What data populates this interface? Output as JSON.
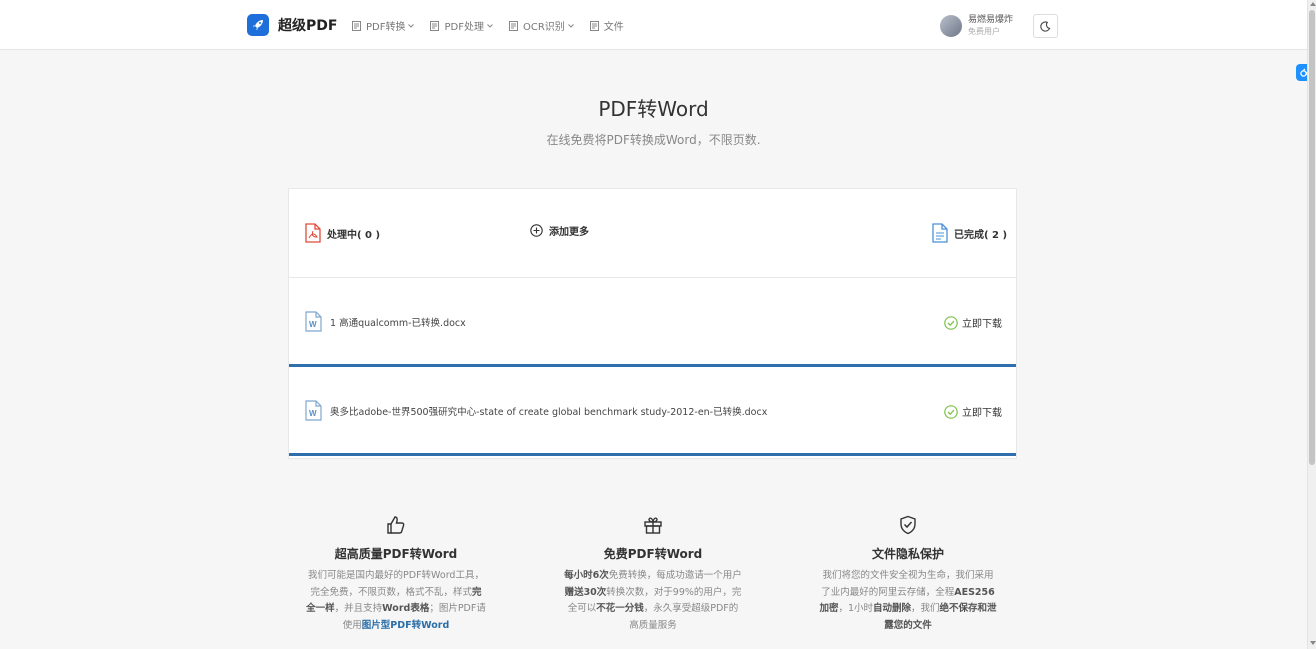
{
  "header": {
    "brand": "超级PDF",
    "nav": [
      {
        "label": "PDF转换",
        "icon": "document-icon",
        "dropdown": true
      },
      {
        "label": "PDF处理",
        "icon": "document-icon",
        "dropdown": true
      },
      {
        "label": "OCR识别",
        "icon": "document-icon",
        "dropdown": true
      },
      {
        "label": "文件",
        "icon": "document-icon",
        "dropdown": false
      }
    ],
    "user": {
      "name": "易燃易爆炸",
      "role": "免费用户"
    },
    "theme_icon": "moon-icon"
  },
  "hero": {
    "title": "PDF转Word",
    "subtitle": "在线免费将PDF转换成Word，不限页数."
  },
  "panel": {
    "processing": "处理中( 0 )",
    "add_more": "添加更多",
    "completed": "已完成( 2 )",
    "files": [
      {
        "name": "1 高通qualcomm-已转换.docx",
        "action": "立即下载"
      },
      {
        "name": "奥多比adobe-世界500强研究中心-state of create global benchmark study-2012-en-已转换.docx",
        "action": "立即下载"
      }
    ]
  },
  "features": [
    {
      "icon": "thumbs-up-icon",
      "title": "超高质量PDF转Word",
      "text_a": "我们可能是国内最好的PDF转Word工具，完全免费，不限页数，格式不乱，样式",
      "bold_a": "完全一样",
      "text_b": "，并且支持",
      "bold_b": "Word表格",
      "text_c": "；图片PDF请使用",
      "link": "图片型PDF转Word"
    },
    {
      "icon": "gift-icon",
      "title": "免费PDF转Word",
      "bold_a": "每小时6次",
      "text_a": "免费转换，每成功邀请一个用户",
      "bold_b": "赠送30次",
      "text_b": "转换次数，对于99%的用户，完全可以",
      "bold_c": "不花一分钱",
      "text_c": "，永久享受超级PDF的高质量服务"
    },
    {
      "icon": "shield-check-icon",
      "title": "文件隐私保护",
      "text_a": "我们将您的文件安全视为生命，我们采用了业内最好的阿里云存储，全程",
      "bold_a": "AES256加密",
      "text_b": "，1小时",
      "bold_b": "自动删除",
      "text_c": "，我们",
      "bold_c": "绝不保存和泄露您的文件"
    }
  ],
  "colors": {
    "brand": "#1e6fd9",
    "pdf_red": "#e04a3a",
    "doc_blue": "#4a90d9",
    "success_green": "#7cc24a",
    "row_border": "#2f6fad"
  }
}
